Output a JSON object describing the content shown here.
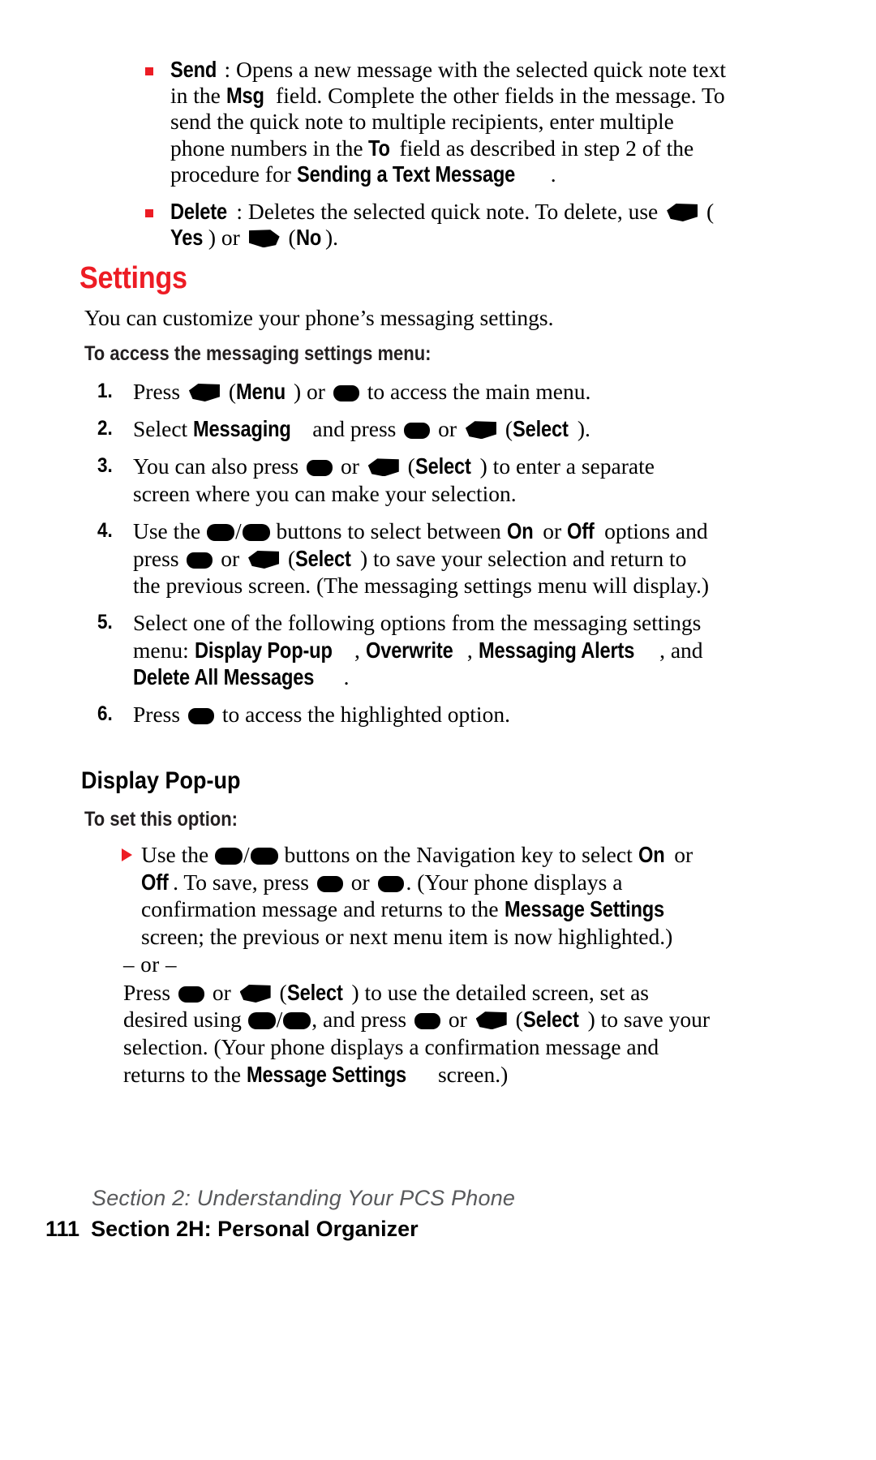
{
  "document": {
    "title": "Settings"
  },
  "bullets": [
    {
      "label": "Send",
      "label_sep": ": ",
      "icon": "square-bullet",
      "parts": [
        {
          "t": "text",
          "v": "Opens a new message with the selected quick note text in the "
        },
        {
          "t": "strong",
          "v": "Msg"
        },
        {
          "t": "text",
          "v": " field. Complete the other fields in the message. To send the quick note to multiple recipients, enter multiple phone numbers in the "
        },
        {
          "t": "strong",
          "v": "To"
        },
        {
          "t": "text",
          "v": " field as described in step 2 of the procedure for "
        },
        {
          "t": "strong",
          "v": "Sending a Text Message"
        },
        {
          "t": "text",
          "v": "."
        }
      ]
    },
    {
      "label": "Delete",
      "label_sep": ": ",
      "icon": "square-bullet",
      "parts": [
        {
          "t": "text",
          "v": "Deletes the selected quick note. To delete, use "
        },
        {
          "t": "key",
          "v": "soft-left"
        },
        {
          "t": "text",
          "v": " ("
        },
        {
          "t": "strong",
          "v": "Yes"
        },
        {
          "t": "text",
          "v": ") or "
        },
        {
          "t": "key",
          "v": "soft-right"
        },
        {
          "t": "text",
          "v": " ("
        },
        {
          "t": "strong",
          "v": "No"
        },
        {
          "t": "text",
          "v": ")."
        }
      ]
    }
  ],
  "section": {
    "heading": "Settings",
    "heading_color": "#ed1c24",
    "intro": "You can customize your phone’s messaging settings.",
    "procedure_heading": "To access the messaging settings menu:",
    "steps": [
      {
        "number": "1.",
        "parts": [
          {
            "t": "text",
            "v": "Press "
          },
          {
            "t": "key",
            "v": "soft-left"
          },
          {
            "t": "text",
            "v": " ("
          },
          {
            "t": "strong",
            "v": "Menu"
          },
          {
            "t": "text",
            "v": ") or "
          },
          {
            "t": "key",
            "v": "ok"
          },
          {
            "t": "text",
            "v": " to access the main menu."
          }
        ]
      },
      {
        "number": "2.",
        "parts": [
          {
            "t": "text",
            "v": "Select "
          },
          {
            "t": "strong",
            "v": "Messaging"
          },
          {
            "t": "text",
            "v": " and press "
          },
          {
            "t": "key",
            "v": "ok"
          },
          {
            "t": "text",
            "v": " or "
          },
          {
            "t": "key",
            "v": "soft-left"
          },
          {
            "t": "text",
            "v": " ("
          },
          {
            "t": "strong",
            "v": "Select"
          },
          {
            "t": "text",
            "v": ")."
          }
        ]
      },
      {
        "number": "3.",
        "parts": [
          {
            "t": "text",
            "v": "You can also press "
          },
          {
            "t": "key",
            "v": "ok"
          },
          {
            "t": "text",
            "v": " or "
          },
          {
            "t": "key",
            "v": "soft-left"
          },
          {
            "t": "text",
            "v": " ("
          },
          {
            "t": "strong",
            "v": "Select"
          },
          {
            "t": "text",
            "v": ") to enter a separate screen where you can make your selection."
          }
        ]
      },
      {
        "number": "4.",
        "parts": [
          {
            "t": "text",
            "v": "Use the "
          },
          {
            "t": "key",
            "v": "nav"
          },
          {
            "t": "slash",
            "v": "/"
          },
          {
            "t": "key",
            "v": "nav"
          },
          {
            "t": "text",
            "v": " buttons to select between "
          },
          {
            "t": "strong",
            "v": "On"
          },
          {
            "t": "text",
            "v": " or "
          },
          {
            "t": "strong",
            "v": "Off"
          },
          {
            "t": "text",
            "v": " options and press "
          },
          {
            "t": "key",
            "v": "ok"
          },
          {
            "t": "text",
            "v": " or "
          },
          {
            "t": "key",
            "v": "soft-left"
          },
          {
            "t": "text",
            "v": " ("
          },
          {
            "t": "strong",
            "v": "Select"
          },
          {
            "t": "text",
            "v": ") to save your selection and return to the previous screen. (The messaging settings menu will display.)"
          }
        ]
      },
      {
        "number": "5.",
        "parts": [
          {
            "t": "text",
            "v": "Select one of the following options from the messaging settings menu: "
          },
          {
            "t": "strong",
            "v": "Display Pop-up"
          },
          {
            "t": "text",
            "v": ", "
          },
          {
            "t": "strong",
            "v": "Overwrite"
          },
          {
            "t": "text",
            "v": ", "
          },
          {
            "t": "strong",
            "v": "Messaging Alerts"
          },
          {
            "t": "text",
            "v": ", and "
          },
          {
            "t": "strong",
            "v": "Delete All Messages"
          },
          {
            "t": "text",
            "v": "."
          }
        ]
      },
      {
        "number": "6.",
        "parts": [
          {
            "t": "text",
            "v": "Press "
          },
          {
            "t": "key",
            "v": "ok"
          },
          {
            "t": "text",
            "v": " to access the highlighted option."
          }
        ]
      }
    ]
  },
  "subsection": {
    "heading": "Display Pop-up",
    "procedure_heading": "To set this option:",
    "bullet_icon": "triangle-bullet",
    "paragraph1": [
      {
        "t": "text",
        "v": "Use the "
      },
      {
        "t": "key",
        "v": "nav"
      },
      {
        "t": "slash",
        "v": "/"
      },
      {
        "t": "key",
        "v": "nav"
      },
      {
        "t": "text",
        "v": " buttons on the Navigation key to select "
      },
      {
        "t": "strong",
        "v": "On"
      },
      {
        "t": "text",
        "v": " or "
      },
      {
        "t": "strong",
        "v": "Off"
      },
      {
        "t": "text",
        "v": ". To save, press "
      },
      {
        "t": "key",
        "v": "ok"
      },
      {
        "t": "text",
        "v": " or "
      },
      {
        "t": "key",
        "v": "ok"
      },
      {
        "t": "text",
        "v": ". (Your phone displays a confirmation message and returns to the "
      },
      {
        "t": "strong",
        "v": "Message Settings"
      },
      {
        "t": "text",
        "v": " screen; the previous or next menu item is now highlighted.)"
      }
    ],
    "or_divider": "– or –",
    "paragraph2": [
      {
        "t": "text",
        "v": "Press "
      },
      {
        "t": "key",
        "v": "ok"
      },
      {
        "t": "text",
        "v": " or "
      },
      {
        "t": "key",
        "v": "soft-left"
      },
      {
        "t": "text",
        "v": " ("
      },
      {
        "t": "strong",
        "v": "Select"
      },
      {
        "t": "text",
        "v": ") to use the detailed screen, set as desired using "
      },
      {
        "t": "key",
        "v": "nav"
      },
      {
        "t": "slash",
        "v": "/"
      },
      {
        "t": "key",
        "v": "nav"
      },
      {
        "t": "text",
        "v": ", and press "
      },
      {
        "t": "key",
        "v": "ok"
      },
      {
        "t": "text",
        "v": " or "
      },
      {
        "t": "key",
        "v": "soft-left"
      },
      {
        "t": "text",
        "v": " ("
      },
      {
        "t": "strong",
        "v": "Select"
      },
      {
        "t": "text",
        "v": ") to save your selection. (Your phone displays a confirmation message and returns to the "
      },
      {
        "t": "strong",
        "v": "Message Settings"
      },
      {
        "t": "text",
        "v": " screen.)"
      }
    ]
  },
  "footer": {
    "running_head": "Section 2: Understanding Your PCS Phone",
    "page_number": "111",
    "section_label": "Section 2H: Personal Organizer"
  }
}
